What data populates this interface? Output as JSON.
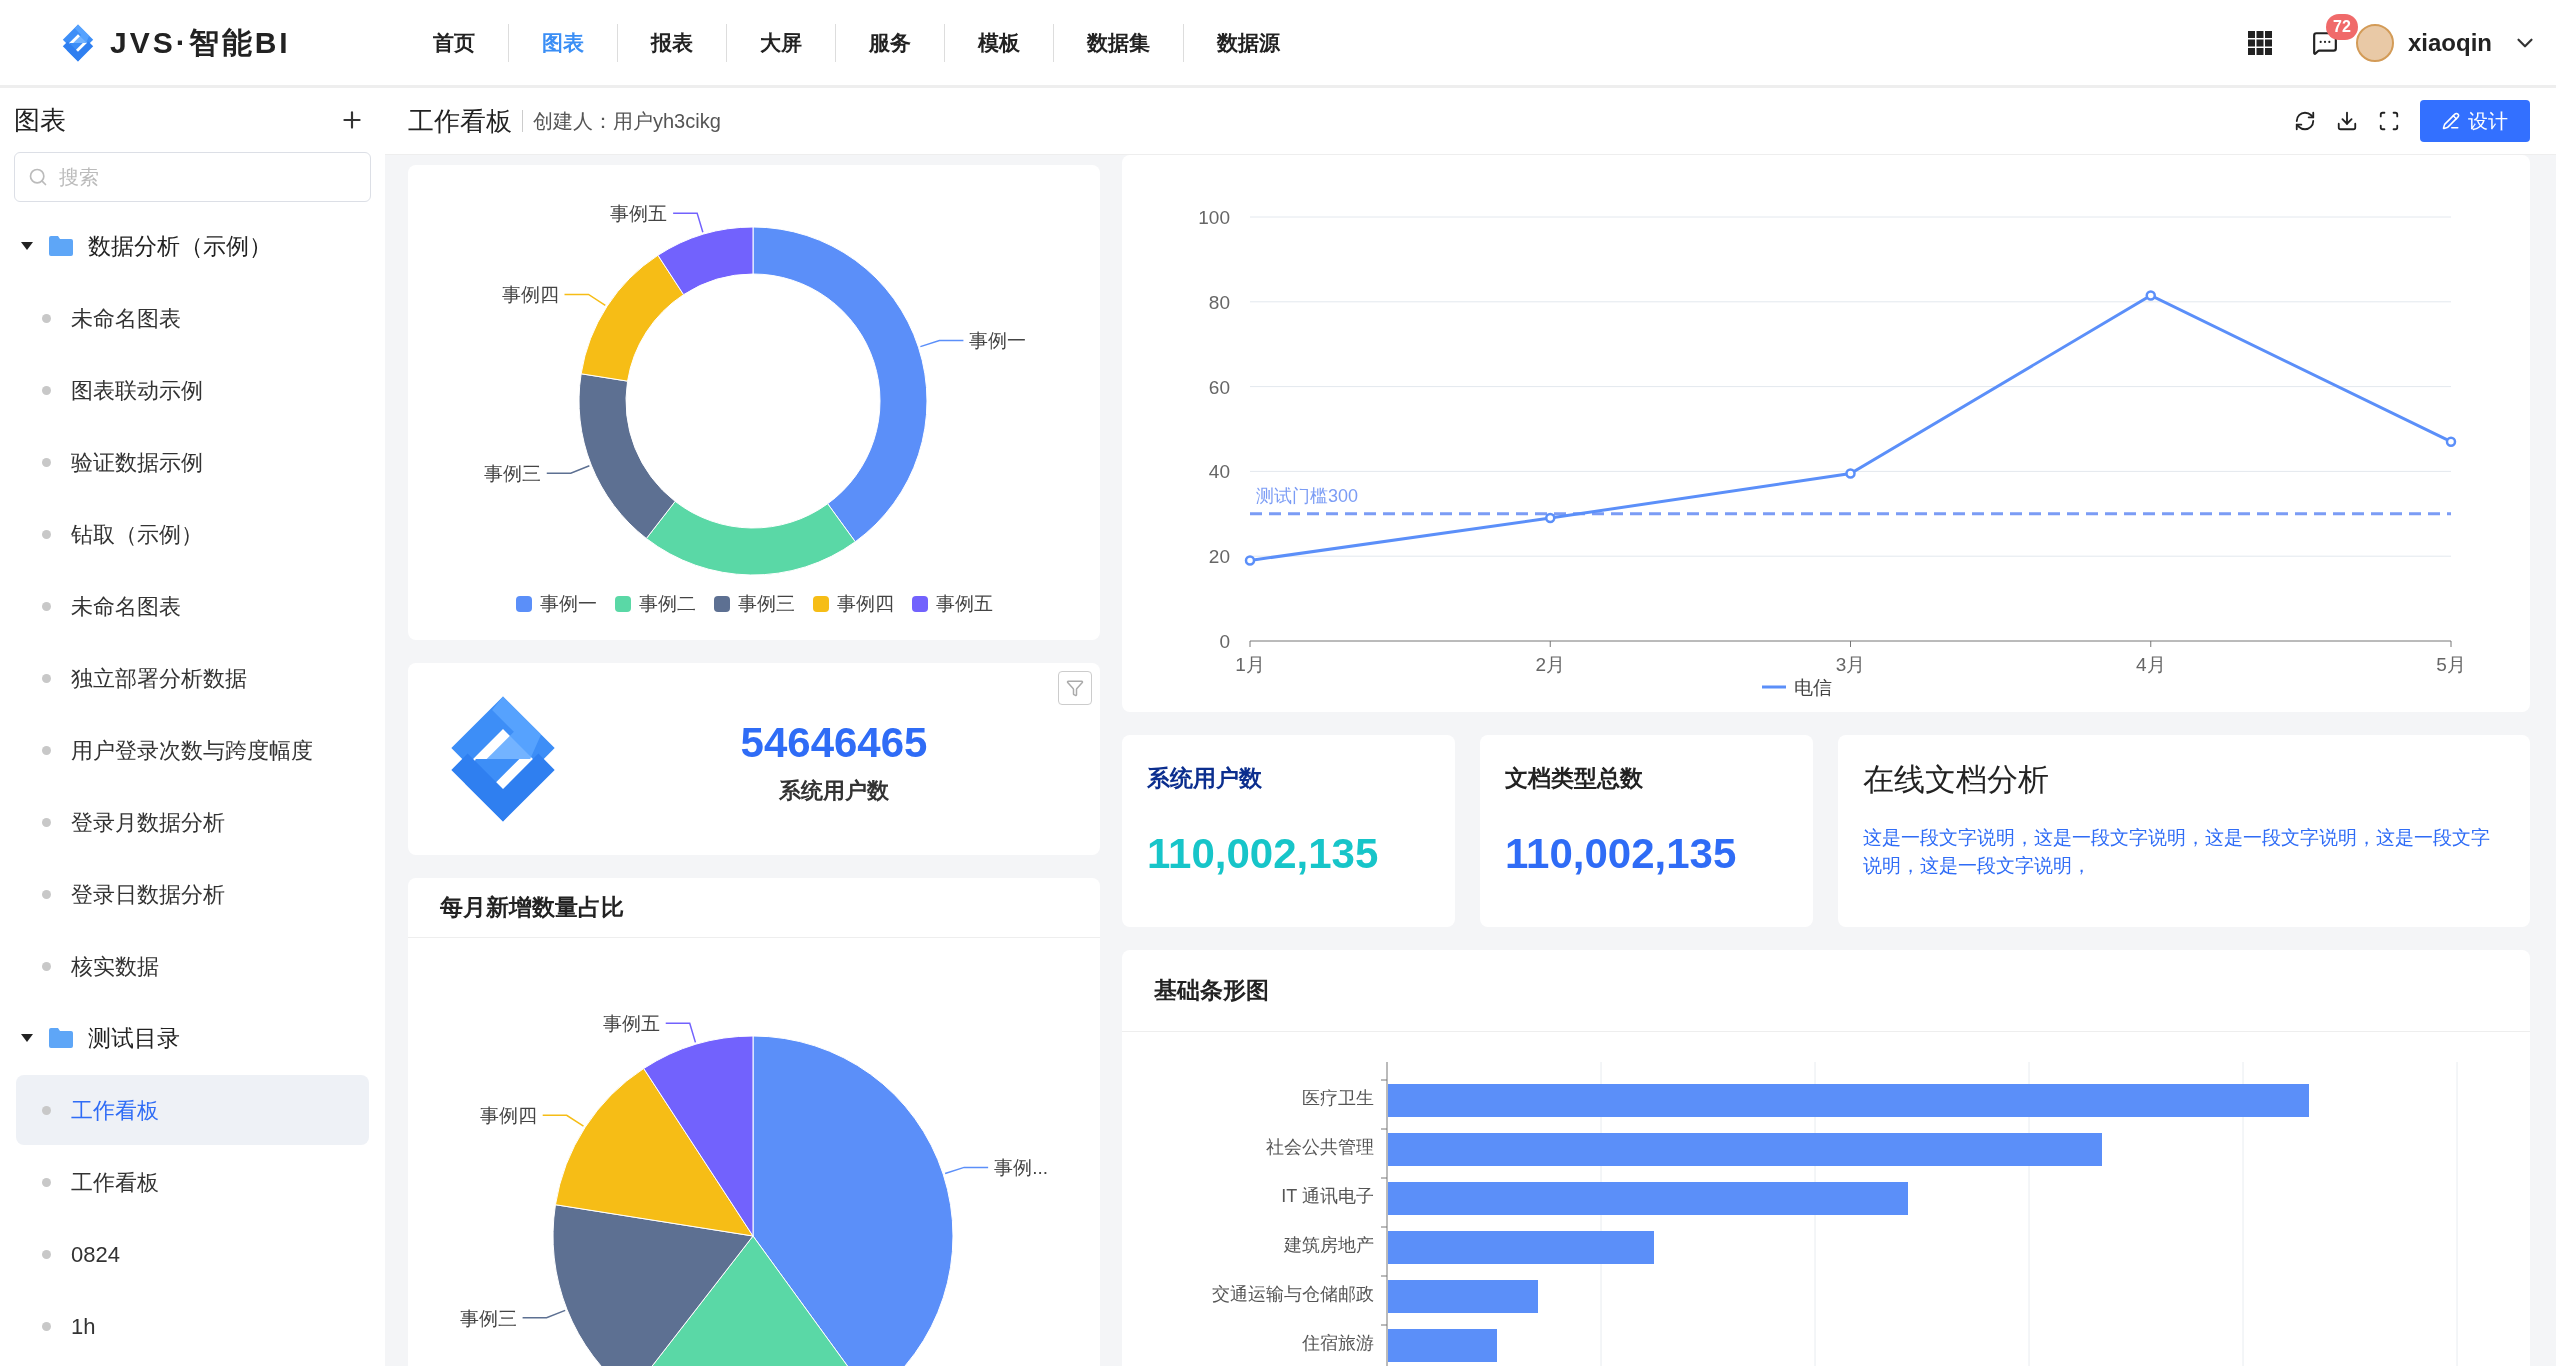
{
  "header": {
    "logo_text": "JVS·智能BI",
    "nav": [
      {
        "label": "首页",
        "selected": false
      },
      {
        "label": "图表",
        "selected": true
      },
      {
        "label": "报表",
        "selected": false
      },
      {
        "label": "大屏",
        "selected": false
      },
      {
        "label": "服务",
        "selected": false
      },
      {
        "label": "模板",
        "selected": false
      },
      {
        "label": "数据集",
        "selected": false
      },
      {
        "label": "数据源",
        "selected": false
      }
    ],
    "notification_count": "72",
    "username": "xiaoqin"
  },
  "sidebar": {
    "title": "图表",
    "search": {
      "placeholder": "搜索"
    },
    "tree": [
      {
        "label": "数据分析（示例）",
        "expanded": true,
        "children": [
          {
            "label": "未命名图表",
            "selected": false
          },
          {
            "label": "图表联动示例",
            "selected": false
          },
          {
            "label": "验证数据示例",
            "selected": false
          },
          {
            "label": "钻取（示例）",
            "selected": false
          },
          {
            "label": "未命名图表",
            "selected": false
          },
          {
            "label": "独立部署分析数据",
            "selected": false
          },
          {
            "label": "用户登录次数与跨度幅度",
            "selected": false
          },
          {
            "label": "登录月数据分析",
            "selected": false
          },
          {
            "label": "登录日数据分析",
            "selected": false
          },
          {
            "label": "核实数据",
            "selected": false
          }
        ]
      },
      {
        "label": "测试目录",
        "expanded": true,
        "children": [
          {
            "label": "工作看板",
            "selected": true
          },
          {
            "label": "工作看板",
            "selected": false
          },
          {
            "label": "0824",
            "selected": false
          },
          {
            "label": "1h",
            "selected": false
          }
        ]
      }
    ]
  },
  "toolbar": {
    "title": "工作看板",
    "creator": "创建人：用户yh3cikg",
    "design_button": "设计"
  },
  "donut_card": {
    "slices": [
      {
        "label": "事例一",
        "color": "#5b8ff9"
      },
      {
        "color": "#5ad8a6"
      },
      {
        "label": "事例三",
        "color": "#5d7092"
      },
      {
        "label": "事例四",
        "color": "#f6bd16"
      },
      {
        "label": "事例五",
        "color": "#7262fd"
      }
    ],
    "legend": [
      {
        "label": "事例一",
        "color": "#5b8ff9"
      },
      {
        "label": "事例二",
        "color": "#5ad8a6"
      },
      {
        "label": "事例三",
        "color": "#5d7092"
      },
      {
        "label": "事例四",
        "color": "#f6bd16"
      },
      {
        "label": "事例五",
        "color": "#7262fd"
      }
    ]
  },
  "metric_card": {
    "value": "54646465",
    "label": "系统用户数"
  },
  "pie_card": {
    "title": "每月新增数量占比",
    "slices": [
      {
        "label": "事例...",
        "color": "#5b8ff9"
      },
      {
        "color": "#5ad8a6"
      },
      {
        "label": "事例三",
        "color": "#5d7092"
      },
      {
        "label": "事例四",
        "color": "#f6bd16"
      },
      {
        "label": "事例五",
        "color": "#7262fd"
      }
    ]
  },
  "line_card": {
    "chart_data": {
      "type": "line",
      "categories": [
        "1月",
        "2月",
        "3月",
        "4月",
        "5月"
      ],
      "series": [
        {
          "name": "电信",
          "color": "#5b8ff9",
          "marker": "circle",
          "values": [
            19,
            29,
            39.5,
            81.5,
            47
          ]
        }
      ],
      "ylim": [
        0,
        100
      ],
      "yticks": [
        0,
        20,
        40,
        60,
        80,
        100
      ],
      "grid": true,
      "ref_lines": [
        {
          "axis": "y",
          "value": 30,
          "label": "测试门槛300",
          "color": "#7b9cf5"
        }
      ]
    }
  },
  "stat_cards": [
    {
      "kind": "metric",
      "title": "系统用户数",
      "value": "110,002,135",
      "color": "#17c5c9"
    },
    {
      "kind": "metric",
      "title": "文档类型总数",
      "value": "110,002,135",
      "color": "#2f6cf6"
    },
    {
      "kind": "text",
      "title": "在线文档分析",
      "description": "这是一段文字说明，这是一段文字说明，这是一段文字说明，这是一段文字说明，这是一段文字说明，"
    }
  ],
  "bar_card": {
    "title": "基础条形图",
    "categories": [
      "医疗卫生",
      "社会公共管理",
      "IT 通讯电子",
      "建筑房地产",
      "交通运输与仓储邮政",
      "住宿旅游"
    ]
  }
}
